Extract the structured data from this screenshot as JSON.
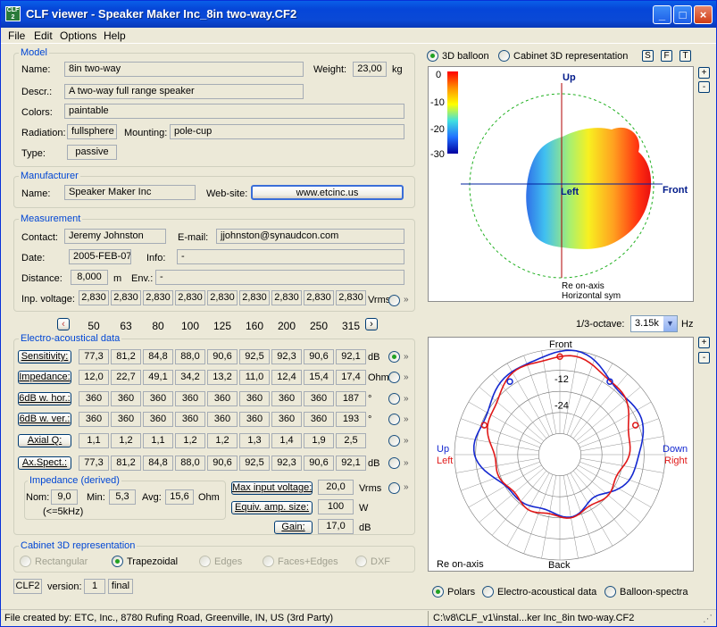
{
  "window": {
    "title": "CLF viewer - Speaker Maker Inc_8in two-way.CF2",
    "icon_text": "CLF\n2"
  },
  "menu": [
    "File",
    "Edit",
    "Options",
    "Help"
  ],
  "model": {
    "group": "Model",
    "name_label": "Name:",
    "name": "8in two-way",
    "weight_label": "Weight:",
    "weight": "23,00",
    "weight_unit": "kg",
    "descr_label": "Descr.:",
    "descr": "A two-way full range speaker",
    "colors_label": "Colors:",
    "colors": "paintable",
    "radiation_label": "Radiation:",
    "radiation": "fullsphere",
    "mounting_label": "Mounting:",
    "mounting": "pole-cup",
    "type_label": "Type:",
    "type": "passive"
  },
  "manufacturer": {
    "group": "Manufacturer",
    "name_label": "Name:",
    "name": "Speaker Maker Inc",
    "website_label": "Web-site:",
    "website": "www.etcinc.us"
  },
  "measurement": {
    "group": "Measurement",
    "contact_label": "Contact:",
    "contact": "Jeremy Johnston",
    "email_label": "E-mail:",
    "email": "jjohnston@synaudcon.com",
    "date_label": "Date:",
    "date": "2005-FEB-07",
    "info_label": "Info:",
    "info": "-",
    "distance_label": "Distance:",
    "distance": "8,000",
    "distance_unit": "m",
    "env_label": "Env.:",
    "env": "-",
    "inp_voltage_label": "Inp. voltage:",
    "inp_voltage": [
      "2,830",
      "2,830",
      "2,830",
      "2,830",
      "2,830",
      "2,830",
      "2,830",
      "2,830",
      "2,830"
    ],
    "inp_voltage_unit": "Vrms"
  },
  "freqs": [
    "50",
    "63",
    "80",
    "100",
    "125",
    "160",
    "200",
    "250",
    "315"
  ],
  "electro": {
    "group": "Electro-acoustical data",
    "rows": [
      {
        "label": "Sensitivity:",
        "values": [
          "77,3",
          "81,2",
          "84,8",
          "88,0",
          "90,6",
          "92,5",
          "92,3",
          "90,6",
          "92,1"
        ],
        "unit": "dB",
        "selected": true
      },
      {
        "label": "Impedance:",
        "values": [
          "12,0",
          "22,7",
          "49,1",
          "34,2",
          "13,2",
          "11,0",
          "12,4",
          "15,4",
          "17,4"
        ],
        "unit": "Ohm",
        "selected": false
      },
      {
        "label": "6dB w. hor.:",
        "values": [
          "360",
          "360",
          "360",
          "360",
          "360",
          "360",
          "360",
          "360",
          "187"
        ],
        "unit": "°",
        "selected": false
      },
      {
        "label": "6dB w. ver.:",
        "values": [
          "360",
          "360",
          "360",
          "360",
          "360",
          "360",
          "360",
          "360",
          "193"
        ],
        "unit": "°",
        "selected": false
      },
      {
        "label": "Axial Q:",
        "values": [
          "1,1",
          "1,2",
          "1,1",
          "1,2",
          "1,2",
          "1,3",
          "1,4",
          "1,9",
          "2,5"
        ],
        "unit": "",
        "selected": false
      },
      {
        "label": "Ax.Spect.:",
        "values": [
          "77,3",
          "81,2",
          "84,8",
          "88,0",
          "90,6",
          "92,5",
          "92,3",
          "90,6",
          "92,1"
        ],
        "unit": "dB",
        "selected": false
      }
    ]
  },
  "impedance": {
    "group": "Impedance (derived)",
    "nom_label": "Nom:",
    "nom": "9,0",
    "min_label": "Min:",
    "min": "5,3",
    "avg_label": "Avg:",
    "avg": "15,6",
    "unit": "Ohm",
    "note": "(<=5kHz)"
  },
  "maxv": {
    "label": "Max input voltage:",
    "value": "20,0",
    "unit": "Vrms"
  },
  "equiv": {
    "label": "Equiv. amp. size:",
    "value": "100",
    "unit": "W"
  },
  "gain": {
    "label": "Gain:",
    "value": "17,0",
    "unit": "dB"
  },
  "cabinet": {
    "group": "Cabinet 3D representation",
    "options": [
      "Rectangular",
      "Trapezoidal",
      "Edges",
      "Faces+Edges",
      "DXF"
    ],
    "selected": "Trapezoidal"
  },
  "footer": {
    "format": "CLF2",
    "version_label": "version:",
    "version": "1",
    "final": "final"
  },
  "view": {
    "opt1": "3D balloon",
    "opt2": "Cabinet 3D representation",
    "btns": [
      "S",
      "F",
      "T"
    ],
    "plus": "+",
    "minus": "-"
  },
  "balloon": {
    "scale": [
      "0",
      "-10",
      "-20",
      "-30"
    ],
    "up": "Up",
    "left": "Left",
    "front": "Front",
    "note1": "Re on-axis",
    "note2": "Horizontal sym"
  },
  "octave": {
    "label": "1/3-octave:",
    "value": "3.15k",
    "unit": "Hz"
  },
  "polar": {
    "front": "Front",
    "back": "Back",
    "up": "Up",
    "left": "Left",
    "down": "Down",
    "right": "Right",
    "r1": "-12",
    "r2": "-24",
    "note": "Re on-axis"
  },
  "bottom_opts": [
    "Polars",
    "Electro-acoustical data",
    "Balloon-spectra"
  ],
  "status": {
    "left": "File created by: ETC, Inc., 8780 Rufing Road, Greenville, IN, US (3rd Party)",
    "right": "C:\\v8\\CLF_v1\\instal...ker Inc_8in two-way.CF2"
  },
  "colors": {
    "accent": "#0046d5",
    "blue_trace": "#1428d0",
    "red_trace": "#e01818",
    "titlebar": "#0a5fe8"
  }
}
